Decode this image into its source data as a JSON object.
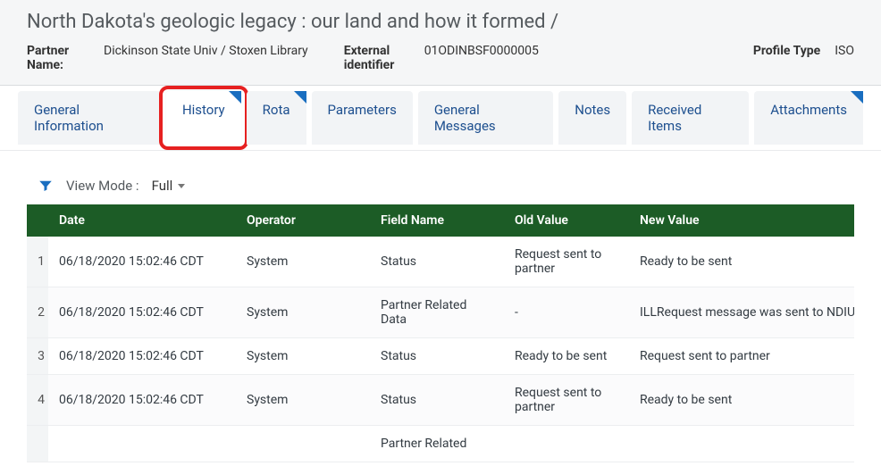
{
  "header": {
    "title": "North Dakota's geologic legacy : our land and how it formed /",
    "partner_label": "Partner Name:",
    "partner_value": "Dickinson State Univ / Stoxen Library",
    "extid_label": "External identifier",
    "extid_value": "01ODINBSF0000005",
    "profile_label": "Profile Type",
    "profile_value": "ISO"
  },
  "tabs": [
    {
      "label": "General Information",
      "corner": false
    },
    {
      "label": "History",
      "corner": true,
      "active": true,
      "highlight": true
    },
    {
      "label": "Rota",
      "corner": true
    },
    {
      "label": "Parameters",
      "corner": false
    },
    {
      "label": "General Messages",
      "corner": false
    },
    {
      "label": "Notes",
      "corner": false
    },
    {
      "label": "Received Items",
      "corner": false
    },
    {
      "label": "Attachments",
      "corner": true
    }
  ],
  "toolbar": {
    "view_mode_label": "View Mode :",
    "view_mode_value": "Full"
  },
  "table": {
    "headers": {
      "date": "Date",
      "operator": "Operator",
      "field": "Field Name",
      "old": "Old Value",
      "new": "New Value"
    },
    "rows": [
      {
        "n": "1",
        "date": "06/18/2020 15:02:46 CDT",
        "operator": "System",
        "field": "Status",
        "old": "Request sent to partner",
        "new": "Ready to be sent"
      },
      {
        "n": "2",
        "date": "06/18/2020 15:02:46 CDT",
        "operator": "System",
        "field": "Partner Related Data",
        "old": "-",
        "new": "ILLRequest message was sent to NDIUT on"
      },
      {
        "n": "3",
        "date": "06/18/2020 15:02:46 CDT",
        "operator": "System",
        "field": "Status",
        "old": "Ready to be sent",
        "new": "Request sent to partner"
      },
      {
        "n": "4",
        "date": "06/18/2020 15:02:46 CDT",
        "operator": "System",
        "field": "Status",
        "old": "Request sent to partner",
        "new": "Ready to be sent"
      },
      {
        "n": "",
        "date": "",
        "operator": "",
        "field": "Partner Related",
        "old": "",
        "new": ""
      }
    ]
  }
}
